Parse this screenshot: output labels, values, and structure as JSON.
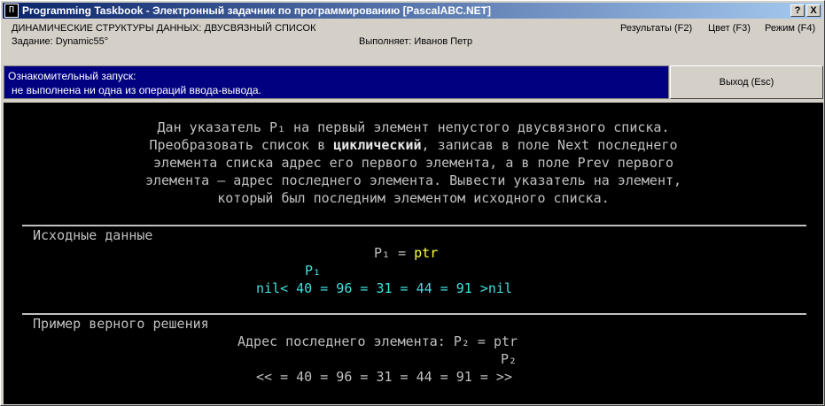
{
  "window": {
    "icon_text": "П",
    "title": "Programming Taskbook - Электронный задачник по программированию [PascalABC.NET]",
    "help_button": "?",
    "close_button": "X"
  },
  "header": {
    "topic": "ДИНАМИЧЕСКИЕ СТРУКТУРЫ ДАННЫХ: ДВУСВЯЗНЫЙ СПИСОК",
    "task": "Задание: Dynamic55°",
    "performer": "Выполняет: Иванов Петр",
    "menu": {
      "results": "Результаты (F2)",
      "color": "Цвет (F3)",
      "mode": "Режим (F4)"
    }
  },
  "status": {
    "line1": "Ознакомительный запуск:",
    "line2": "не выполнена ни одна из операций ввода-вывода.",
    "exit_button": "Выход (Esc)"
  },
  "task_text": {
    "line1": "Дан указатель P₁ на первый элемент непустого двусвязного списка.",
    "line2_pre": "Преобразовать список в ",
    "line2_bold": "циклический",
    "line2_post": ", записав в поле Next последнего",
    "line3": "элемента списка адрес его первого элемента, а в поле Prev первого",
    "line4": "элемента — адрес последнего элемента. Вывести указатель на элемент,",
    "line5": "который был последним элементом исходного списка."
  },
  "input_section": {
    "title": "Исходные данные",
    "pointer_label": "P₁ = ",
    "pointer_value": "ptr",
    "marker": "P₁",
    "list": "nil< 40 = 96 = 31 = 44 = 91 >nil"
  },
  "example_section": {
    "title": "Пример верного решения",
    "result_label": "Адрес последнего элемента: P₂ = ptr",
    "marker": "P₂",
    "list": "<< = 40 = 96 = 31 = 44 = 91 = >>"
  }
}
